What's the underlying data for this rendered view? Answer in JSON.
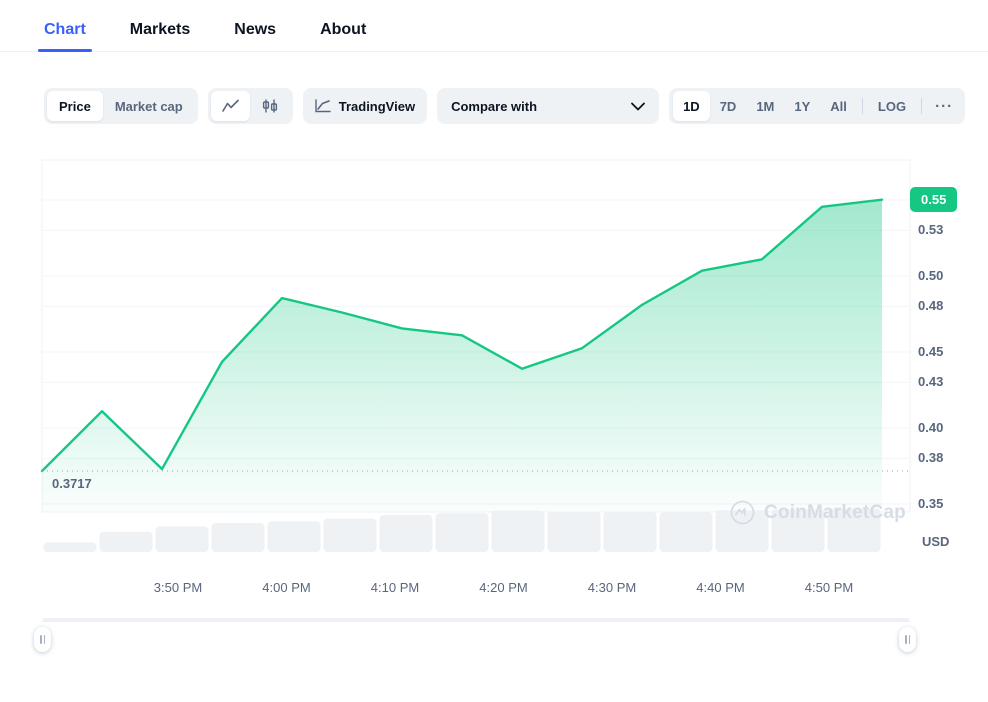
{
  "tabs": [
    {
      "label": "Chart",
      "active": true
    },
    {
      "label": "Markets",
      "active": false
    },
    {
      "label": "News",
      "active": false
    },
    {
      "label": "About",
      "active": false
    }
  ],
  "toolbar": {
    "price_label": "Price",
    "marketcap_label": "Market cap",
    "line_icon": "line-chart-icon",
    "candle_icon": "candlestick-icon",
    "tradingview_label": "TradingView",
    "tradingview_icon": "tradingview-icon",
    "compare_label": "Compare with",
    "compare_chevron": "chevron-down-icon",
    "ranges": [
      "1D",
      "7D",
      "1M",
      "1Y",
      "All"
    ],
    "active_range": "1D",
    "log_label": "LOG",
    "more_label": "···"
  },
  "chart_data": {
    "type": "area",
    "title": "",
    "xlabel": "",
    "ylabel": "USD",
    "currency": "USD",
    "line_color": "#16c784",
    "fill_color": "#16c784",
    "volume_color": "#eff2f5",
    "ylim": [
      0.35,
      0.56
    ],
    "yticks": [
      "0.55",
      "0.53",
      "0.50",
      "0.48",
      "0.45",
      "0.43",
      "0.40",
      "0.38",
      "0.35"
    ],
    "ytick_values": [
      0.55,
      0.53,
      0.5,
      0.48,
      0.45,
      0.43,
      0.4,
      0.38,
      0.35
    ],
    "current_price_badge": "0.55",
    "current_price_value": 0.5502,
    "low_marker_label": "0.3717",
    "low_marker_value": 0.3717,
    "xticks": [
      "3:50 PM",
      "4:00 PM",
      "4:10 PM",
      "4:20 PM",
      "4:30 PM",
      "4:40 PM",
      "4:50 PM"
    ],
    "xtick_values": [
      "15:50",
      "16:00",
      "16:10",
      "16:20",
      "16:30",
      "16:40",
      "16:50"
    ],
    "x": [
      "15:45",
      "15:50",
      "15:55",
      "16:00",
      "16:05",
      "16:10",
      "16:15",
      "16:20",
      "16:25",
      "16:30",
      "16:35",
      "16:40",
      "16:45",
      "16:50",
      "16:55"
    ],
    "values": [
      0.3717,
      0.411,
      0.373,
      0.4435,
      0.4855,
      0.476,
      0.4655,
      0.461,
      0.439,
      0.4525,
      0.481,
      0.5035,
      0.511,
      0.5455,
      0.5502
    ],
    "volume": [
      0.22,
      0.46,
      0.58,
      0.66,
      0.7,
      0.76,
      0.84,
      0.88,
      0.94,
      0.92,
      0.91,
      0.9,
      0.95,
      0.97,
      0.99
    ],
    "grid": true,
    "legend": null,
    "watermark": "CoinMarketCap",
    "watermark_icon": "coinmarketcap-logo-icon"
  },
  "brush": {
    "left_handle": "brush-handle-left",
    "right_handle": "brush-handle-right"
  }
}
